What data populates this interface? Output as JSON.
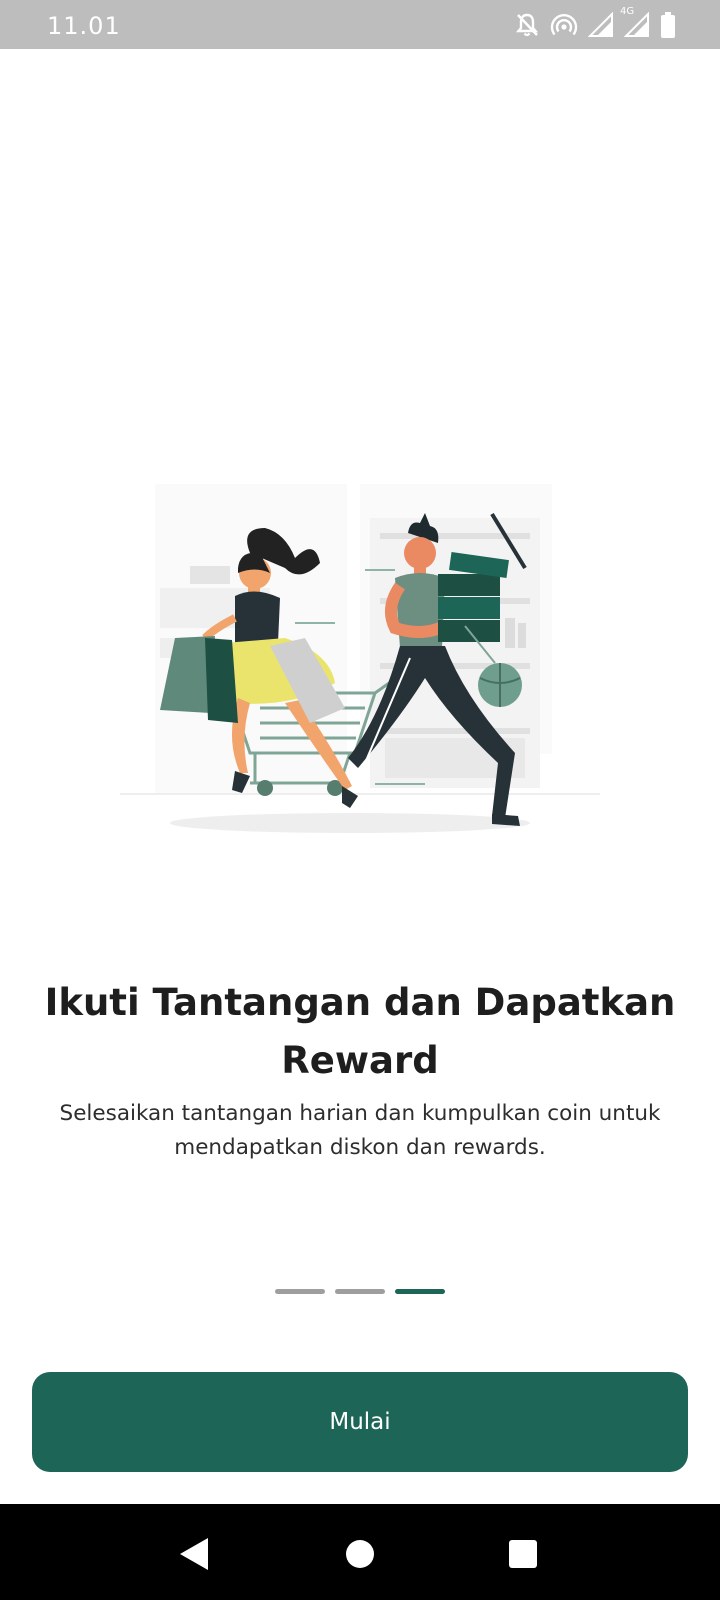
{
  "status_bar": {
    "time": "11.01",
    "network_label": "4G",
    "icons": [
      "notifications-off-icon",
      "hotspot-icon",
      "signal-icon",
      "signal-4g-icon",
      "battery-icon"
    ]
  },
  "onboarding": {
    "illustration": "shopping-couple-illustration",
    "title": "Ikuti Tantangan dan Dapatkan Reward",
    "subtitle": "Selesaikan tantangan harian dan kumpulkan coin untuk mendapatkan diskon dan rewards.",
    "page_indicator": {
      "total": 3,
      "current": 3
    },
    "start_button_label": "Mulai"
  },
  "navigation": {
    "icons": [
      "back-icon",
      "home-icon",
      "recents-icon"
    ]
  },
  "colors": {
    "primary": "#1d6657",
    "status_bar_bg": "#bdbdbd",
    "nav_bar_bg": "#000000",
    "indicator_inactive": "#9e9e9e"
  }
}
